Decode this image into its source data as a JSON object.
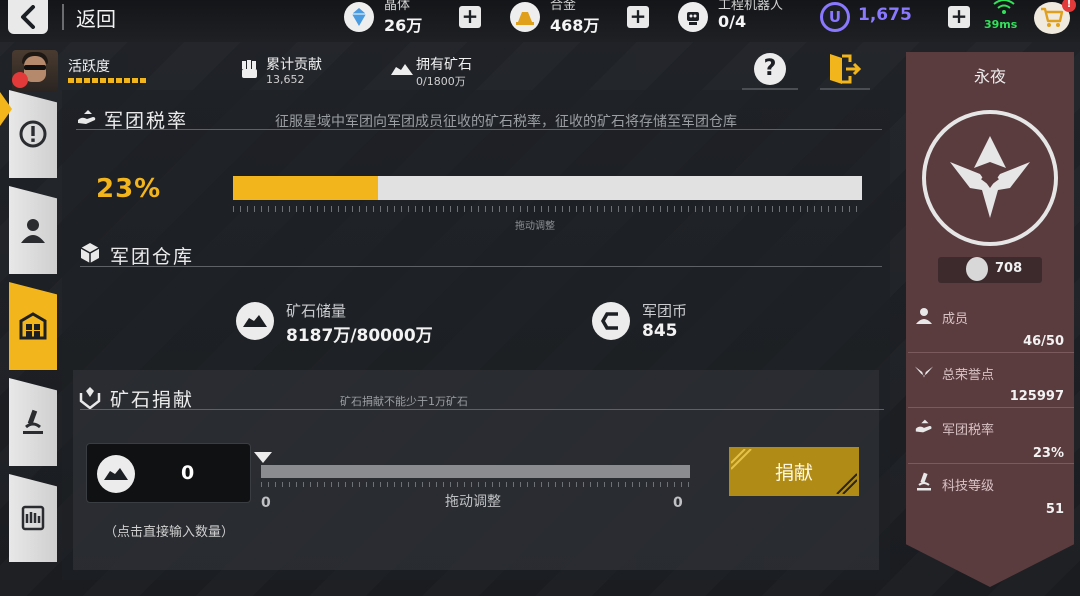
{
  "nav": {
    "back_label": "返回"
  },
  "resources": {
    "crystal": {
      "label": "晶体",
      "value": "26万"
    },
    "alloy": {
      "label": "合金",
      "value": "468万"
    },
    "robot": {
      "label": "工程机器人",
      "value": "0/4"
    },
    "u_currency": {
      "value": "1,675"
    }
  },
  "network": {
    "ping": "39ms"
  },
  "cart": {
    "badge": "!"
  },
  "header": {
    "activity_label": "活跃度",
    "contribution_label": "累计贡献",
    "contribution_value": "13,652",
    "ore_label": "拥有矿石",
    "ore_value": "0/1800万",
    "help_glyph": "?"
  },
  "tax": {
    "title": "军团税率",
    "description": "征服星域中军团向军团成员征收的矿石税率，征收的矿石将存储至军团仓库",
    "percent_label": "23%",
    "percent": 23,
    "hint": "拖动调整"
  },
  "warehouse": {
    "title": "军团仓库",
    "ore_label": "矿石储量",
    "ore_value": "8187万/80000万",
    "coin_label": "军团币",
    "coin_value": "845"
  },
  "donate": {
    "title": "矿石捐献",
    "note": "矿石捐献不能少于1万矿石",
    "quantity": "0",
    "quantity_hint": "（点击直接输入数量）",
    "slider_min": "0",
    "slider_max": "0",
    "slider_hint": "拖动调整",
    "button_label": "捐献"
  },
  "legion": {
    "name": "永夜",
    "power": "708",
    "members_label": "成员",
    "members_value": "46/50",
    "honor_label": "总荣誉点",
    "honor_value": "125997",
    "tax_label": "军团税率",
    "tax_value": "23%",
    "tech_label": "科技等级",
    "tech_value": "51"
  },
  "colors": {
    "accent": "#f2b51c",
    "u_currency": "#8a78ff",
    "ping": "#32e05a",
    "legion_panel": "#5a3c3f"
  }
}
